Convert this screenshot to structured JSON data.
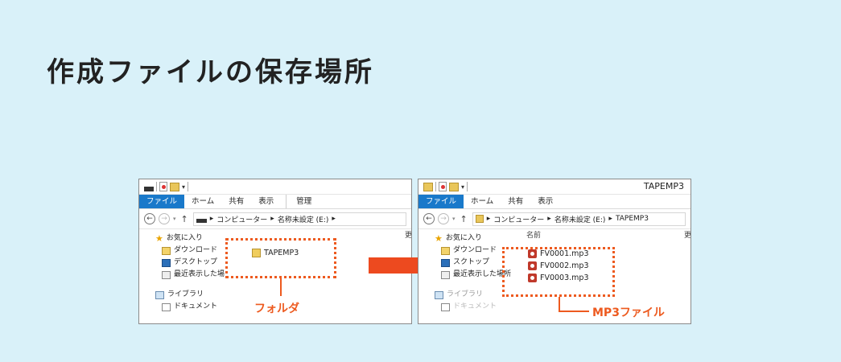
{
  "page": {
    "title": "作成ファイルの保存場所",
    "bg": "#d9f1f9"
  },
  "colors": {
    "accent": "#ed5a1f",
    "ribbon_file": "#1979ca"
  },
  "left_window": {
    "ribbon": {
      "file": "ファイル",
      "home": "ホーム",
      "share": "共有",
      "view": "表示",
      "manage": "管理"
    },
    "address": {
      "computer": "コンピューター",
      "drive": "名称未設定 (E:)",
      "sep": "▸"
    },
    "col_header": "更",
    "nav": {
      "favorites": "お気に入り",
      "downloads": "ダウンロード",
      "desktop": "デスクトップ",
      "recent": "最近表示した場",
      "libraries": "ライブラリ",
      "documents": "ドキュメント"
    },
    "folder_name": "TAPEMP3",
    "callout": "フォルダ"
  },
  "right_window": {
    "window_title": "TAPEMP3",
    "ribbon": {
      "file": "ファイル",
      "home": "ホーム",
      "share": "共有",
      "view": "表示"
    },
    "address": {
      "computer": "コンピューター",
      "drive": "名称未設定 (E:)",
      "folder": "TAPEMP3",
      "sep": "▸"
    },
    "col_name": "名前",
    "col_header": "更",
    "nav": {
      "favorites": "お気に入り",
      "downloads": "ダウンロード",
      "desktop": "スクトップ",
      "recent": "最近表示した場所",
      "libraries": "ライブラリ",
      "documents": "ドキュメント"
    },
    "files": [
      "FV0001.mp3",
      "FV0002.mp3",
      "FV0003.mp3"
    ],
    "callout": "MP3ファイル"
  },
  "icons": [
    "star-icon",
    "download-folder-icon",
    "desktop-icon",
    "recent-icon",
    "library-icon",
    "folder-icon",
    "mp3-file-icon",
    "right-arrow-icon"
  ]
}
